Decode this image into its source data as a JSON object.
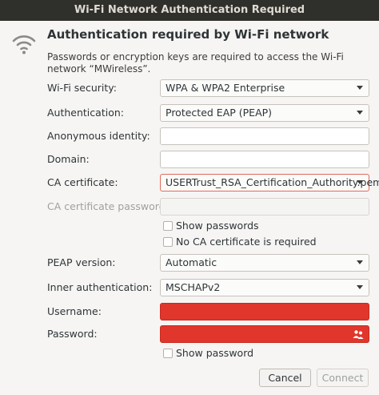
{
  "window": {
    "title": "Wi-Fi Network Authentication Required"
  },
  "header": {
    "title": "Authentication required by Wi-Fi network",
    "description": "Passwords or encryption keys are required to access the Wi-Fi network “MWireless”."
  },
  "form": {
    "wifi_security": {
      "label": "Wi-Fi security:",
      "value": "WPA & WPA2 Enterprise"
    },
    "authentication": {
      "label": "Authentication:",
      "value": "Protected EAP (PEAP)"
    },
    "anonymous_identity": {
      "label": "Anonymous identity:",
      "value": ""
    },
    "domain": {
      "label": "Domain:",
      "value": ""
    },
    "ca_certificate": {
      "label": "CA certificate:",
      "value": "USERTrust_RSA_Certification_Authority.pem"
    },
    "ca_certificate_password": {
      "label": "CA certificate password:",
      "value": ""
    },
    "show_passwords": {
      "label": "Show passwords",
      "checked": false
    },
    "no_ca_required": {
      "label": "No CA certificate is required",
      "checked": false
    },
    "peap_version": {
      "label": "PEAP version:",
      "value": "Automatic"
    },
    "inner_authentication": {
      "label": "Inner authentication:",
      "value": "MSCHAPv2"
    },
    "username": {
      "label": "Username:",
      "value": ""
    },
    "password": {
      "label": "Password:",
      "value": ""
    },
    "show_password": {
      "label": "Show password",
      "checked": false
    }
  },
  "buttons": {
    "cancel": "Cancel",
    "connect": "Connect"
  },
  "colors": {
    "titlebar": "#2f2f2b",
    "error_field": "#e0362b",
    "background": "#f6f5f4"
  },
  "icons": {
    "header": "wifi-icon",
    "password_options": "user-group-icon"
  }
}
